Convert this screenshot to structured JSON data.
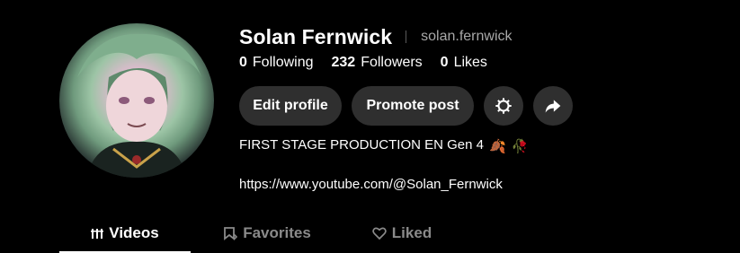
{
  "profile": {
    "display_name": "Solan Fernwick",
    "handle": "solan.fernwick",
    "avatar_icon": "avatar-anime-character"
  },
  "stats": {
    "following": {
      "count": "0",
      "label": "Following"
    },
    "followers": {
      "count": "232",
      "label": "Followers"
    },
    "likes": {
      "count": "0",
      "label": "Likes"
    }
  },
  "actions": {
    "edit_profile_label": "Edit profile",
    "promote_post_label": "Promote post",
    "settings_icon": "gear-icon",
    "share_icon": "share-arrow-icon"
  },
  "bio": {
    "text": "FIRST STAGE PRODUCTION EN Gen 4",
    "emoji": [
      "🍂",
      "🥀"
    ],
    "link": "https://www.youtube.com/@Solan_Fernwick"
  },
  "tabs": [
    {
      "label": "Videos",
      "icon": "bars-icon",
      "active": true
    },
    {
      "label": "Favorites",
      "icon": "bookmark-icon",
      "active": false
    },
    {
      "label": "Liked",
      "icon": "heart-icon",
      "active": false
    }
  ],
  "colors": {
    "background": "#000000",
    "button_bg": "#2f2f2f",
    "muted_text": "#a8a8a8",
    "inactive_tab": "#8a8a8a"
  }
}
